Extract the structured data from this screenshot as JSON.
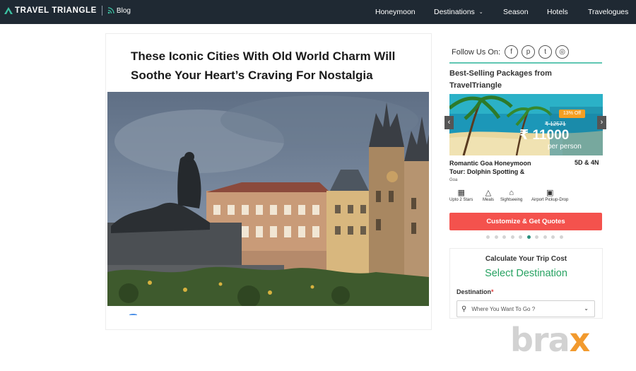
{
  "brand": {
    "name": "TRAVEL TRIANGLE",
    "blog_label": "Blog"
  },
  "nav": {
    "items": [
      "Honeymoon",
      "Destinations",
      "Season",
      "Hotels",
      "Travelogues"
    ]
  },
  "article": {
    "title": "These Iconic Cities With Old World Charm Will Soothe Your Heart’s Craving For Nostalgia"
  },
  "sidebar": {
    "follow_label": "Follow Us On:",
    "social_icons": [
      "facebook-icon",
      "pinterest-icon",
      "twitter-icon",
      "instagram-icon"
    ],
    "best_selling_heading": "Best-Selling Packages from TravelTriangle",
    "package": {
      "offer": "13% Off",
      "old_price": "₹ 12571",
      "price": "₹ 11000",
      "per": "per person",
      "name": "Romantic Goa Honeymoon Tour: Dolphin Spotting &",
      "duration": "5D & 4N",
      "destination": "Goa",
      "amenities": [
        "Upto 2 Stars",
        "Meals",
        "Sightseeing",
        "Airport Pickup-Drop"
      ]
    },
    "cta_label": "Customize & Get Quotes",
    "carousel": {
      "count": 10,
      "active": 5
    }
  },
  "calculator": {
    "title": "Calculate Your Trip Cost",
    "subtitle": "Select Destination",
    "field_label": "Destination",
    "required_mark": "*",
    "placeholder": "Where You Want To Go ?"
  },
  "watermark": {
    "text_main": "bra",
    "text_accent": "x"
  },
  "colors": {
    "topbar": "#1f2933",
    "accent_green": "#27a262",
    "cta_red": "#f4524d",
    "teal_rule": "#5fc7b3",
    "offer_orange": "#f59f22"
  }
}
